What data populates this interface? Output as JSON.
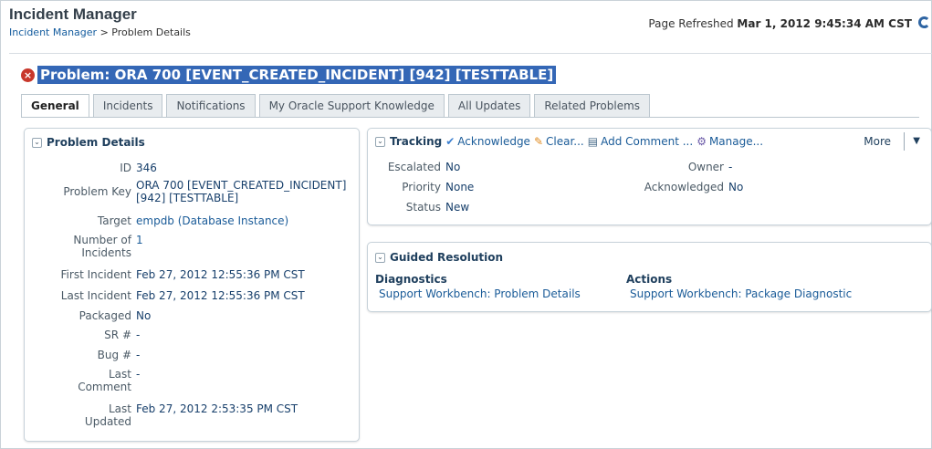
{
  "header": {
    "app_title": "Incident Manager",
    "breadcrumb_root": "Incident Manager",
    "breadcrumb_sep": " > ",
    "breadcrumb_current": "Problem Details",
    "refresh_label": "Page Refreshed ",
    "refresh_time": "Mar 1, 2012 9:45:34 AM CST"
  },
  "problem": {
    "icon": "error-icon",
    "title": "Problem: ORA 700 [EVENT_CREATED_INCIDENT] [942] [TESTTABLE]"
  },
  "tabs": [
    {
      "label": "General",
      "active": true
    },
    {
      "label": "Incidents"
    },
    {
      "label": "Notifications"
    },
    {
      "label": "My Oracle Support Knowledge"
    },
    {
      "label": "All Updates"
    },
    {
      "label": "Related Problems"
    }
  ],
  "problem_details": {
    "title": "Problem Details",
    "fields": {
      "id_label": "ID",
      "id_value": "346",
      "key_label": "Problem Key",
      "key_value_1": "ORA 700 [EVENT_CREATED_INCIDENT]",
      "key_value_2": "[942] [TESTTABLE]",
      "target_label": "Target",
      "target_value": "empdb  (Database Instance)",
      "num_label_1": "Number of",
      "num_label_2": "Incidents",
      "num_value": "1",
      "first_label": "First Incident",
      "first_value": "Feb 27, 2012 12:55:36 PM CST",
      "last_label": "Last Incident",
      "last_value": "Feb 27, 2012 12:55:36 PM CST",
      "packaged_label": "Packaged",
      "packaged_value": "No",
      "sr_label": "SR #",
      "sr_value": "-",
      "bug_label": "Bug #",
      "bug_value": "-",
      "lc_label_1": "Last",
      "lc_label_2": "Comment",
      "lc_value": "-",
      "lu_label_1": "Last",
      "lu_label_2": "Updated",
      "lu_value": "Feb 27, 2012 2:53:35 PM CST"
    }
  },
  "tracking": {
    "title": "Tracking",
    "actions": {
      "acknowledge": "Acknowledge",
      "clear": "Clear...",
      "add_comment": "Add Comment ...",
      "manage": "Manage..."
    },
    "more": "More",
    "escalated_label": "Escalated",
    "escalated_value": "No",
    "priority_label": "Priority",
    "priority_value": "None",
    "status_label": "Status",
    "status_value": "New",
    "owner_label": "Owner",
    "owner_value": "-",
    "ack_label": "Acknowledged",
    "ack_value": "No"
  },
  "guided_resolution": {
    "title": "Guided Resolution",
    "diagnostics_heading": "Diagnostics",
    "diagnostics_link": "Support Workbench: Problem Details",
    "actions_heading": "Actions",
    "actions_link": "Support Workbench: Package Diagnostic"
  },
  "colors": {
    "accent": "#3467b6",
    "error": "#c8372b",
    "link": "#1a5b98"
  }
}
